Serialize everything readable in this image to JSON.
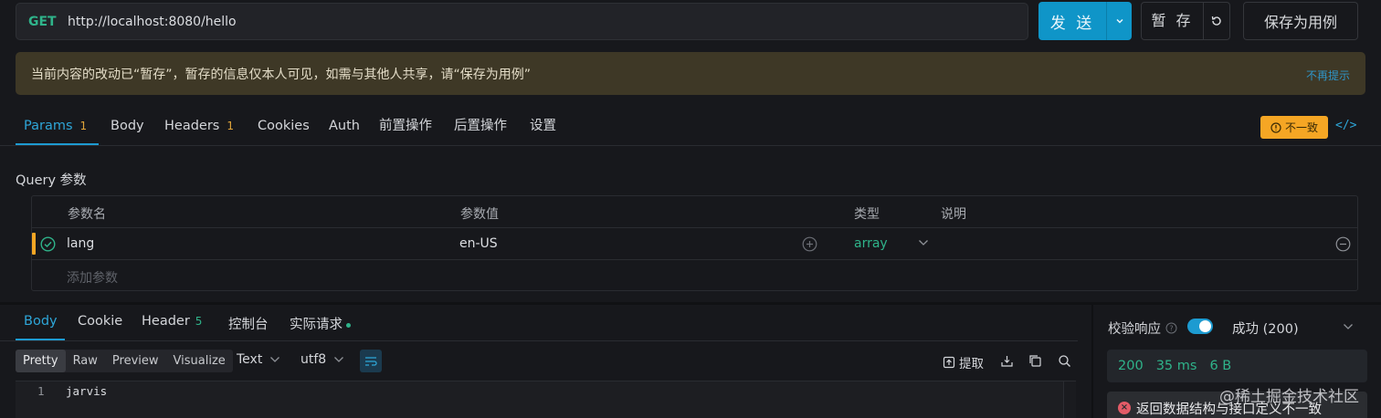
{
  "request": {
    "method": "GET",
    "url": "http://localhost:8080/hello",
    "send_label": "发 送",
    "temp_save_label": "暂 存",
    "save_as_case_label": "保存为用例"
  },
  "notice": {
    "text": "当前内容的改动已“暂存”，暂存的信息仅本人可见，如需与其他人共享，请“保存为用例”",
    "dismiss": "不再提示"
  },
  "tabs": [
    {
      "label": "Params",
      "badge": "1"
    },
    {
      "label": "Body"
    },
    {
      "label": "Headers",
      "badge": "1"
    },
    {
      "label": "Cookies"
    },
    {
      "label": "Auth"
    },
    {
      "label": "前置操作"
    },
    {
      "label": "后置操作"
    },
    {
      "label": "设置"
    }
  ],
  "inconsistent_badge": "不一致",
  "code_toggle": "</>",
  "query": {
    "title": "Query 参数",
    "columns": [
      "参数名",
      "参数值",
      "类型",
      "说明"
    ],
    "rows": [
      {
        "name": "lang",
        "value": "en-US",
        "type": "array",
        "desc": ""
      }
    ],
    "add_placeholder": "添加参数"
  },
  "response_tabs": [
    {
      "label": "Body"
    },
    {
      "label": "Cookie"
    },
    {
      "label": "Header",
      "badge": "5"
    },
    {
      "label": "控制台"
    },
    {
      "label": "实际请求"
    }
  ],
  "view_modes": [
    "Pretty",
    "Raw",
    "Preview",
    "Visualize"
  ],
  "format": "Text",
  "encoding": "utf8",
  "extract_label": "提取",
  "editor": {
    "line_number": "1",
    "content": "jarvis"
  },
  "validation": {
    "label": "校验响应",
    "help": "?",
    "enabled": true,
    "result": "成功 (200)"
  },
  "stats": {
    "status": "200",
    "time": "35 ms",
    "size": "6 B"
  },
  "error_message": "返回数据结构与接口定义不一致",
  "watermark": "@稀土掘金技术社区",
  "colors": {
    "accent": "#1d9bd1",
    "success": "#2fb38a",
    "warning": "#f5a624",
    "error": "#e35b67"
  }
}
